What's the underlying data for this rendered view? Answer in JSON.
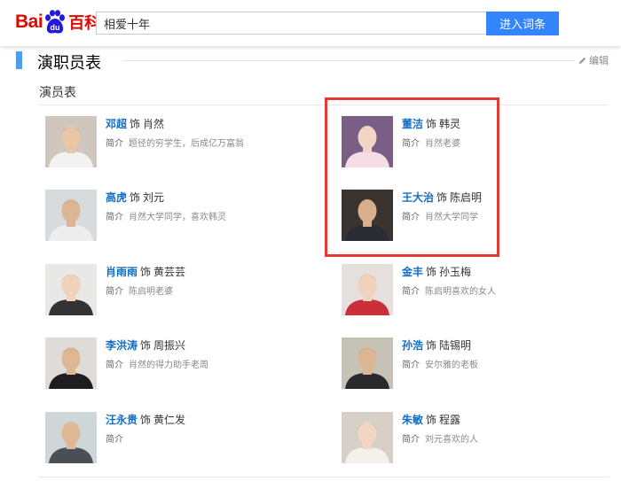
{
  "header": {
    "logo_text": "Bai",
    "logo_paw_label": "du",
    "logo_baike": "百科",
    "search_value": "相爱十年",
    "search_button": "进入词条"
  },
  "section": {
    "title": "演职员表",
    "edit_label": "编辑",
    "subtitle": "演员表"
  },
  "cast_as_label": "饰",
  "cast_intro_label": "简介",
  "cast": [
    {
      "actor": "邓超",
      "role": "肖然",
      "intro": "题径的穷学生，后成亿万富翁",
      "avatar": {
        "bg": "#cfc6bd",
        "skin": "#e9c7a6",
        "hair": "#1f1a17",
        "cloth": "#f2f2f2"
      }
    },
    {
      "actor": "董洁",
      "role": "韩灵",
      "intro": "肖然老婆",
      "avatar": {
        "bg": "#7b5e86",
        "skin": "#f2d6c5",
        "hair": "#2a1e22",
        "cloth": "#f6dce4"
      }
    },
    {
      "actor": "高虎",
      "role": "刘元",
      "intro": "肖然大学同学，喜欢韩灵",
      "avatar": {
        "bg": "#d8dbdd",
        "skin": "#dcb694",
        "hair": "#211c19",
        "cloth": "#ededed"
      }
    },
    {
      "actor": "王大治",
      "role": "陈启明",
      "intro": "肖然大学同学",
      "avatar": {
        "bg": "#3a3430",
        "skin": "#d8b090",
        "hair": "#181412",
        "cloth": "#2b2b35"
      }
    },
    {
      "actor": "肖雨雨",
      "role": "黄芸芸",
      "intro": "陈启明老婆",
      "avatar": {
        "bg": "#e8e8e6",
        "skin": "#efd3bd",
        "hair": "#2a211c",
        "cloth": "#333333"
      }
    },
    {
      "actor": "金丰",
      "role": "孙玉梅",
      "intro": "陈启明喜欢的女人",
      "avatar": {
        "bg": "#e5e0dd",
        "skin": "#f0d2bd",
        "hair": "#5a3f2f",
        "cloth": "#c9303a"
      }
    },
    {
      "actor": "李洪涛",
      "role": "周振兴",
      "intro": "肖然的得力助手老周",
      "avatar": {
        "bg": "#dfdcd7",
        "skin": "#ddb894",
        "hair": "#1c1816",
        "cloth": "#1e1e22"
      }
    },
    {
      "actor": "孙浩",
      "role": "陆锡明",
      "intro": "安尔雅的老板",
      "avatar": {
        "bg": "#c7c2b6",
        "skin": "#dcb693",
        "hair": "#1e1a18",
        "cloth": "#2a2a2e"
      }
    },
    {
      "actor": "汪永贵",
      "role": "黄仁发",
      "intro": "",
      "avatar": {
        "bg": "#cfd6d8",
        "skin": "#dfb895",
        "hair": "#d9d9d9",
        "cloth": "#4a4f55"
      }
    },
    {
      "actor": "朱敏",
      "role": "程露",
      "intro": "刘元喜欢的人",
      "avatar": {
        "bg": "#d6d0c6",
        "skin": "#f2d6c2",
        "hair": "#2b2220",
        "cloth": "#f4f0ec"
      }
    }
  ]
}
